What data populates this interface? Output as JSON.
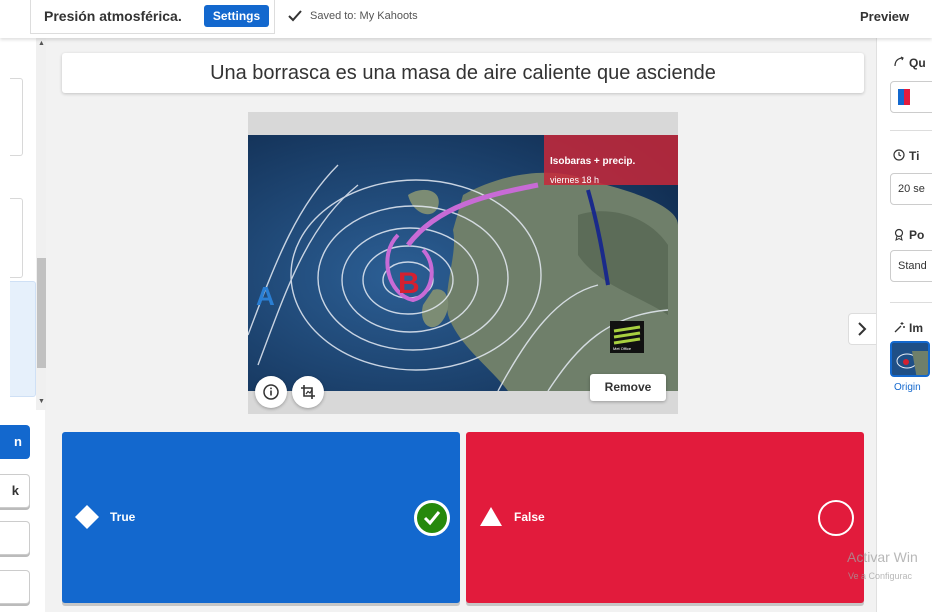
{
  "header": {
    "title": "Presión atmosférica.",
    "settings_label": "Settings",
    "saved_text": "Saved to: My Kahoots",
    "preview_label": "Preview"
  },
  "left_panel": {
    "button_1_label": "n",
    "button_2_label": "k"
  },
  "question": {
    "text": "Una borrasca es una masa de aire caliente que asciende"
  },
  "media": {
    "map_overlay_title": "Isobaras + precip.",
    "map_overlay_subtitle": "viernes 18 h",
    "pressure_low_label": "B",
    "pressure_high_label": "A",
    "logo_text": "Met Office",
    "remove_label": "Remove"
  },
  "answers": [
    {
      "label": "True",
      "color": "#1368ce",
      "shape": "diamond-icon",
      "correct": true
    },
    {
      "label": "False",
      "color": "#e21b3c",
      "shape": "triangle-icon",
      "correct": false
    }
  ],
  "right_panel": {
    "question_type_label": "Qu",
    "time_limit_label": "Ti",
    "time_limit_value": "20 se",
    "points_label": "Po",
    "points_value": "Stand",
    "image_reveal_label": "Im",
    "image_reveal_caption": "Origin"
  },
  "watermark": {
    "line1": "Activar Win",
    "line2": "Ve a Configurac"
  },
  "colors": {
    "accent": "#1368ce",
    "true": "#1368ce",
    "false": "#e21b3c",
    "correct": "#26890c"
  }
}
